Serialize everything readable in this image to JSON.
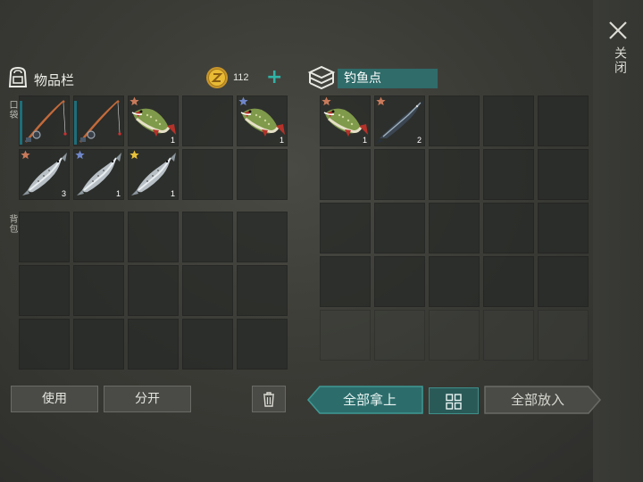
{
  "close": {
    "label": "关闭"
  },
  "inventory": {
    "title": "物品栏",
    "coins": "112",
    "pocket_label": "口袋",
    "backpack_label": "背包",
    "pocket_slots": [
      {
        "item": "fishing-rod-icon",
        "qty": "",
        "star": ""
      },
      {
        "item": "fishing-rod-icon",
        "qty": "",
        "star": ""
      },
      {
        "item": "pike-fish-icon",
        "qty": "1",
        "star": "#c97a5a"
      },
      {
        "item": "",
        "qty": "",
        "star": ""
      },
      {
        "item": "pike-fish-icon",
        "qty": "1",
        "star": "#6f86c9"
      },
      {
        "item": "salmon-fish-icon",
        "qty": "3",
        "star": "#c97a5a"
      },
      {
        "item": "salmon-fish-icon",
        "qty": "1",
        "star": "#6f86c9"
      },
      {
        "item": "salmon-fish-icon",
        "qty": "1",
        "star": "#e8c23a"
      },
      {
        "item": "",
        "qty": "",
        "star": ""
      },
      {
        "item": "",
        "qty": "",
        "star": ""
      }
    ],
    "backpack_slot_count": 15
  },
  "fishing_spot": {
    "title": "钓鱼点",
    "slots": [
      {
        "item": "pike-fish-icon",
        "qty": "1",
        "star": "#c97a5a"
      },
      {
        "item": "sturgeon-fish-icon",
        "qty": "2",
        "star": "#c97a5a"
      }
    ],
    "slot_count": 25
  },
  "buttons": {
    "use": "使用",
    "split": "分开",
    "take_all": "全部拿上",
    "put_all": "全部放入"
  },
  "colors": {
    "accent_teal": "#2fb3a6",
    "take_all_bg": "#2c6d6c",
    "star_bronze": "#c97a5a",
    "star_blue": "#6f86c9",
    "star_gold": "#e8c23a"
  }
}
